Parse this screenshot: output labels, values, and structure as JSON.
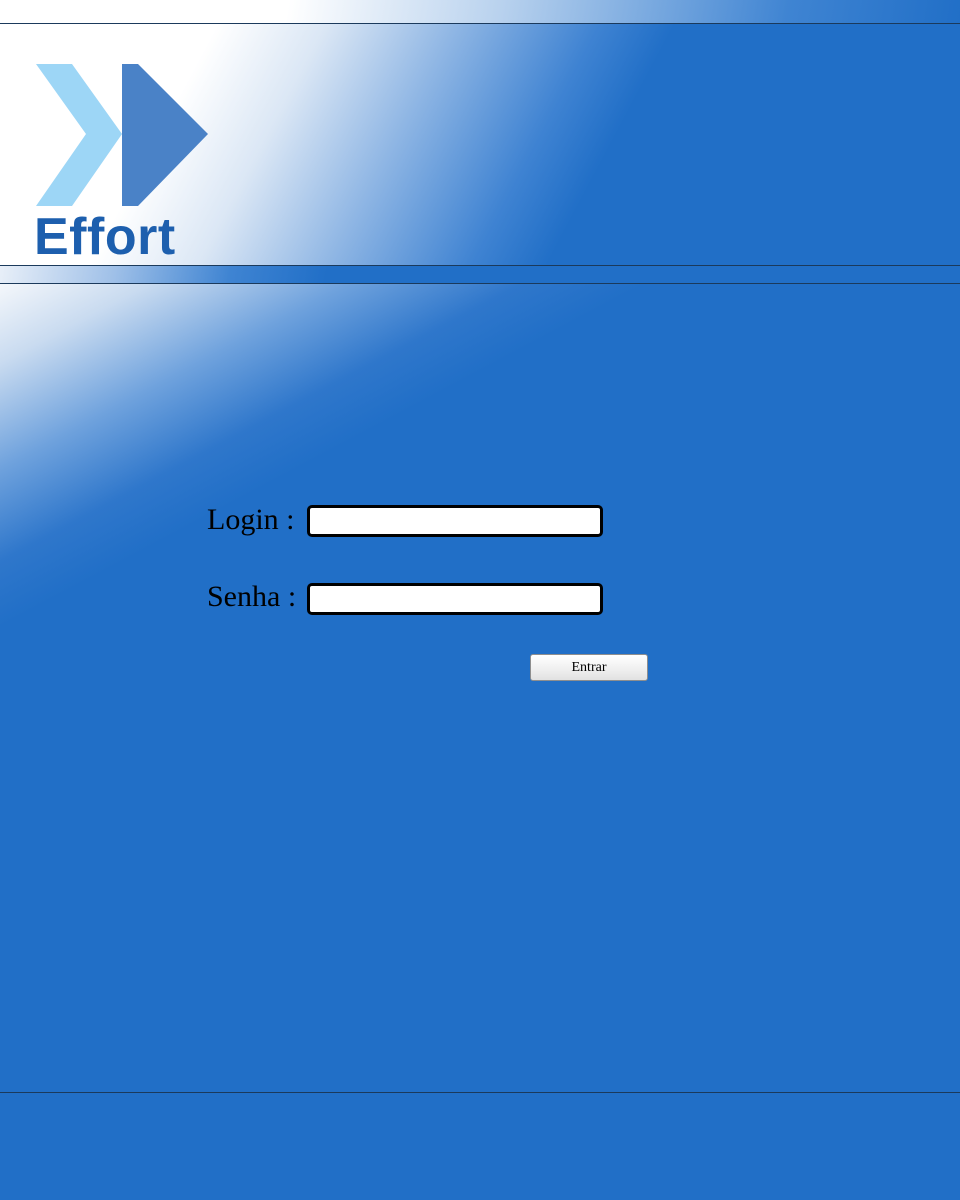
{
  "header": {
    "logo_text": "Effort",
    "logo_icon": "double-chevron-icon"
  },
  "login_form": {
    "login_label": "Login :",
    "login_value": "",
    "senha_label": "Senha :",
    "senha_value": "",
    "submit_label": "Entrar"
  },
  "colors": {
    "background": "#216fc7",
    "logo_text": "#1d5fae",
    "chevron_light": "#9dd6f6",
    "chevron_dark": "#4a82c7"
  }
}
